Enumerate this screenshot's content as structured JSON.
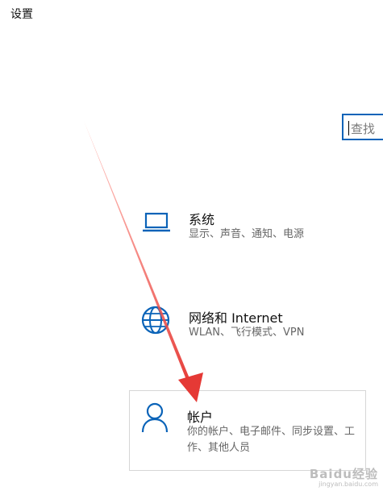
{
  "window": {
    "title": "设置"
  },
  "search": {
    "placeholder": "查找"
  },
  "settings": {
    "system": {
      "title": "系统",
      "desc": "显示、声音、通知、电源",
      "icon": "laptop-icon"
    },
    "network": {
      "title": "网络和 Internet",
      "desc": "WLAN、飞行模式、VPN",
      "icon": "globe-icon"
    },
    "accounts": {
      "title": "帐户",
      "desc": "你的帐户、电子邮件、同步设置、工作、其他人员",
      "icon": "person-icon"
    }
  },
  "colors": {
    "accent": "#0a63b8",
    "arrow": "#e53935"
  },
  "watermark": {
    "logo": "Baidu经验",
    "url": "jingyan.baidu.com"
  }
}
